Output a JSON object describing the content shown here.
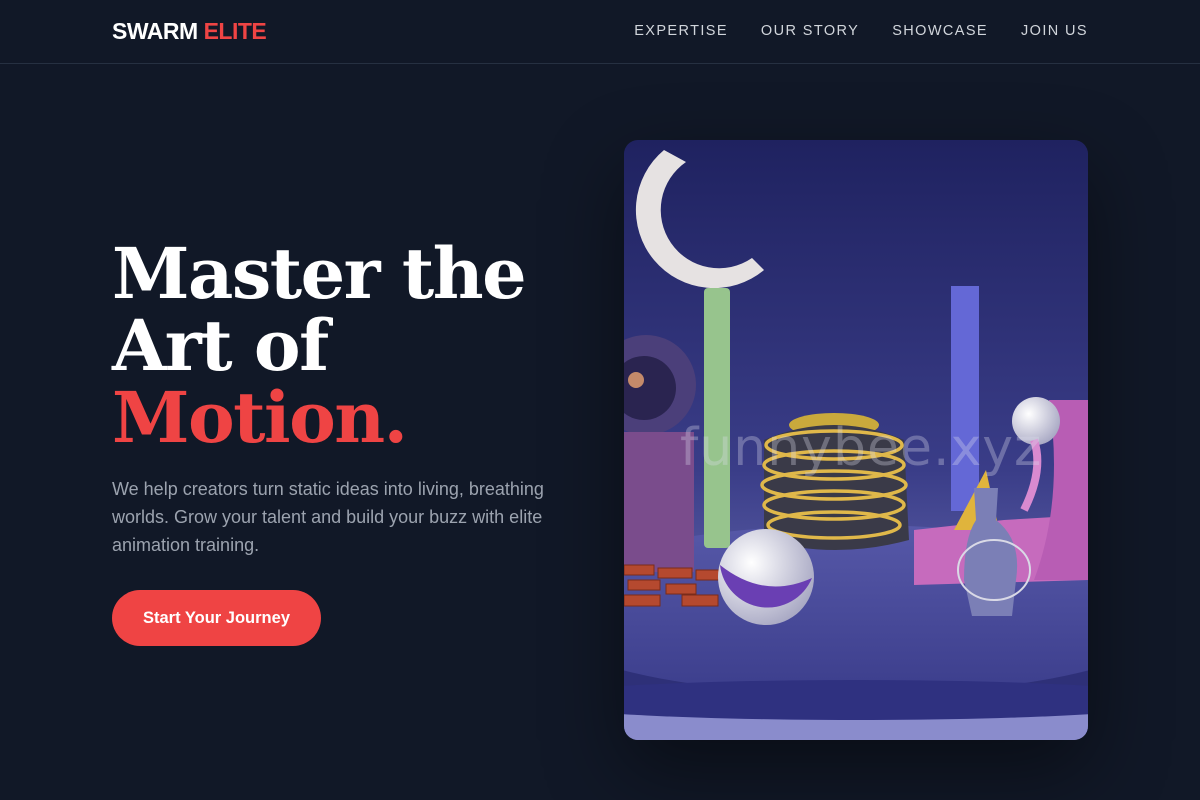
{
  "nav": {
    "logo_main": "SWARM",
    "logo_accent": "ELITE",
    "links": [
      "EXPERTISE",
      "OUR STORY",
      "SHOWCASE",
      "JOIN US"
    ]
  },
  "hero": {
    "title_line1": "Master the",
    "title_line2": "Art of",
    "title_line3": "Motion.",
    "description": "We help creators turn static ideas into living, breathing worlds. Grow your talent and build your buzz with elite animation training.",
    "cta_label": "Start Your Journey"
  },
  "watermark": "funnybee.xyz",
  "colors": {
    "background": "#111827",
    "accent": "#ef4444",
    "text": "#ffffff",
    "muted": "#9ca3af"
  }
}
